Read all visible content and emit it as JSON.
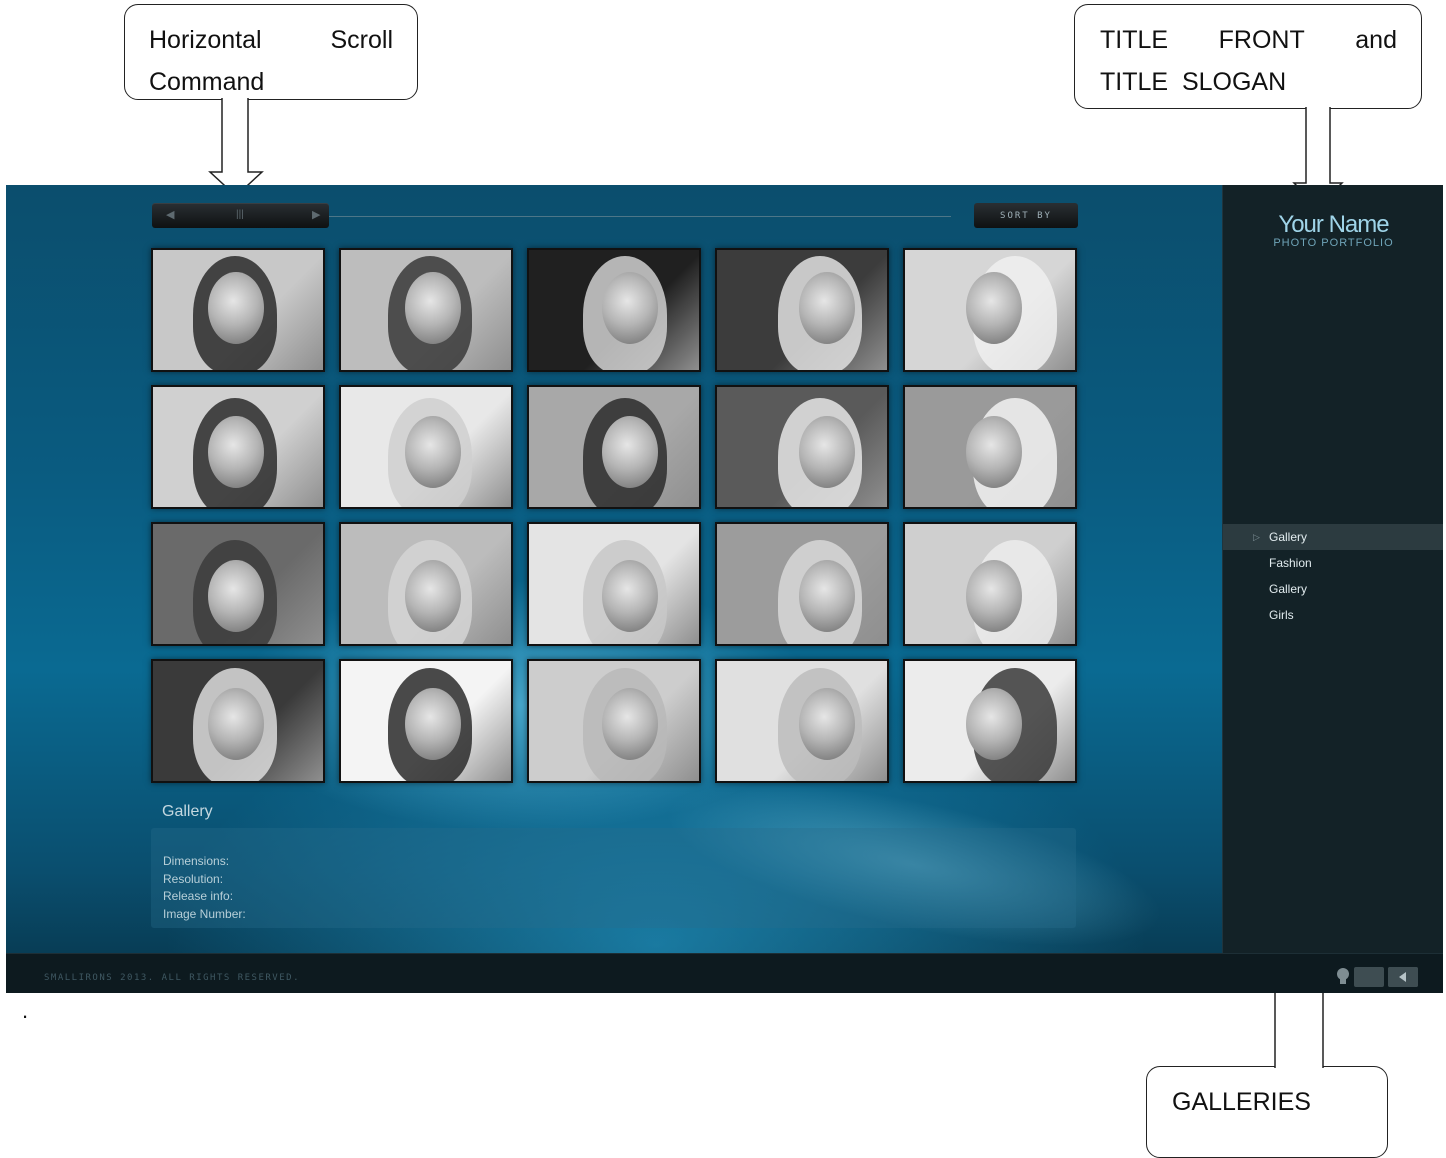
{
  "annotations": {
    "scroll": {
      "line1_left": "Horizontal",
      "line1_right": "Scroll",
      "line2": "Command"
    },
    "title": {
      "line1_left": "TITLE",
      "line1_mid": "FRONT",
      "line1_right": "and",
      "line2": "TITLE  SLOGAN"
    },
    "galleries": {
      "label": "GALLERIES"
    }
  },
  "site": {
    "toolbar": {
      "sort_label": "SORT BY",
      "scroll_prev": "◀",
      "scroll_grip": "|||",
      "scroll_next": "▶"
    },
    "brand": {
      "name": "Your Name",
      "slogan": "PHOTO PORTFOLIO"
    },
    "nav": {
      "items": [
        {
          "label": "Gallery",
          "active": true
        },
        {
          "label": "Fashion",
          "active": false
        },
        {
          "label": "Gallery",
          "active": false
        },
        {
          "label": "Girls",
          "active": false
        }
      ],
      "active_marker": "▷"
    },
    "caption": {
      "title": "Gallery",
      "fields": [
        "Dimensions:",
        "Resolution:",
        "Release info:",
        "Image Number:"
      ]
    },
    "footer": {
      "copyright": "SMALLIRONS 2013. ALL RIGHTS RESERVED."
    },
    "footer_icons": [
      "lightbulb-icon",
      "fullscreen-icon",
      "sound-icon"
    ]
  },
  "page": {
    "dot": "."
  },
  "colors": {
    "background": "#0a5b80",
    "sidebar": "#132227",
    "accent": "#9fd4e8"
  }
}
